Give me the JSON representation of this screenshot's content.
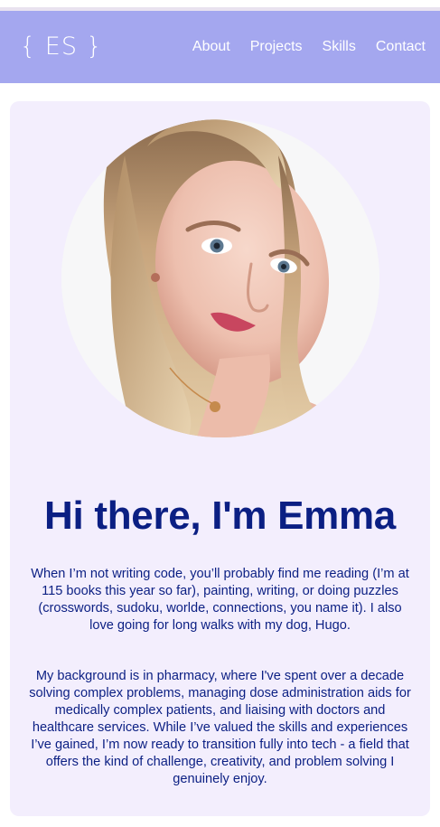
{
  "navbar": {
    "logo": "{ ES }",
    "links": [
      "About",
      "Projects",
      "Skills",
      "Contact"
    ]
  },
  "hero": {
    "heading": "Hi there, I'm Emma",
    "paragraphs": [
      "When I’m not writing code, you’ll probably find me reading (I’m at 115 books this year so far), painting, writing, or doing puzzles (crosswords, sudoku, worlde, connections, you name it). I also love going for long walks with my dog, Hugo.",
      "My background is in pharmacy, where I've spent over a decade solving complex problems, managing dose administration aids for medically complex patients, and liaising with doctors and healthcare services. While I’ve valued the skills and experiences I’ve gained, I’m now ready to transition fully into tech - a field that offers the kind of challenge, creativity, and problem solving I genuinely enjoy."
    ]
  },
  "colors": {
    "navbar_bg": "#a4a7ef",
    "card_bg": "#f3eefd",
    "heading_text": "#0b1f83"
  }
}
